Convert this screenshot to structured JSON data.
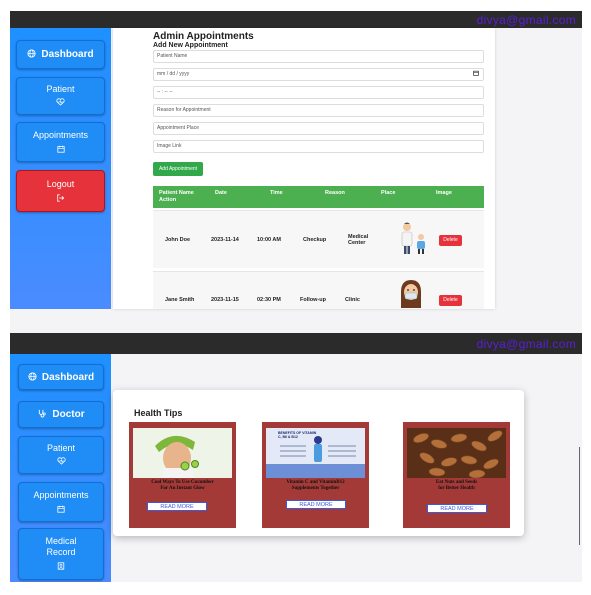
{
  "top_panel": {
    "email": "divya@gmail.com",
    "sidebar": [
      {
        "label": "Dashboard",
        "icon": "globe-icon"
      },
      {
        "label": "Patient",
        "icon": "heart-pulse-icon"
      },
      {
        "label": "Appointments",
        "icon": "calendar-icon"
      },
      {
        "label": "Logout",
        "icon": "logout-icon"
      }
    ],
    "page_title": "Admin Appointments",
    "form_title": "Add New Appointment",
    "fields": {
      "patient_name": "Patient Name",
      "date": "mm / dd / yyyy",
      "time": "-- : --  --",
      "reason": "Reason for Appointment",
      "place": "Appointment Place",
      "image_link": "Image Link"
    },
    "add_button": "Add Appointment",
    "table": {
      "headers": [
        "Patient Name",
        "Date",
        "Time",
        "Reason",
        "Place",
        "Image"
      ],
      "header_second_line": "Action",
      "rows": [
        {
          "name": "John Doe",
          "date": "2023-11-14",
          "time": "10:00 AM",
          "reason": "Checkup",
          "place": "Medical Center",
          "image": "doctor-icon",
          "action": "Delete"
        },
        {
          "name": "Jane Smith",
          "date": "2023-11-15",
          "time": "02:30 PM",
          "reason": "Follow-up",
          "place": "Clinic",
          "image": "nurse-icon",
          "action": "Delete"
        }
      ]
    }
  },
  "bottom_panel": {
    "email": "divya@gmail.com",
    "sidebar": [
      {
        "label": "Dashboard",
        "icon": "globe-icon"
      },
      {
        "label": "Doctor",
        "icon": "stethoscope-icon"
      },
      {
        "label": "Patient",
        "icon": "heart-pulse-icon"
      },
      {
        "label": "Appointments",
        "icon": "calendar-icon"
      },
      {
        "label": "Medical Record",
        "icon": "record-icon"
      }
    ],
    "health_tips": {
      "title": "Health Tips",
      "cards": [
        {
          "text": "Cool Ways To Use Cucumber For An Instant Glow",
          "button": "READ MORE"
        },
        {
          "text": "Vitamin C and VitaminB12 Supplements Together",
          "image_text": "BENEFITS OF VITAMIN C, B6 & B12",
          "button": "READ MORE"
        },
        {
          "text": "Eat Nuts and Seeds for Better Health",
          "button": "READ MORE"
        }
      ]
    }
  },
  "colors": {
    "sidebar": "#1e90ff",
    "table_header": "#4caf50",
    "delete": "#e5323b",
    "card": "#a33a37",
    "email": "#5b1fd6"
  }
}
